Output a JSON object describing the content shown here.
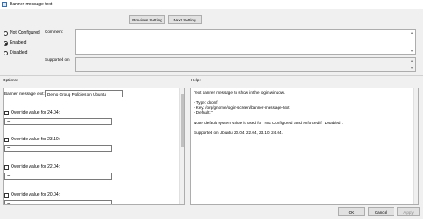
{
  "window": {
    "title": "Banner message text"
  },
  "nav": {
    "previous_label": "Previous Setting",
    "next_label": "Next Setting"
  },
  "state": {
    "options": [
      {
        "label": "Not Configured",
        "selected": false
      },
      {
        "label": "Enabled",
        "selected": true
      },
      {
        "label": "Disabled",
        "selected": false
      }
    ]
  },
  "labels": {
    "comment": "Comment:",
    "supported_on": "Supported on:",
    "options": "Options:",
    "help": "Help:"
  },
  "options_panel": {
    "banner_label": "Banner message text:",
    "banner_value": "Demo Group Policies on Ubuntu",
    "overrides": [
      {
        "label": "Override value for 24.04:",
        "value": "\"\""
      },
      {
        "label": "Override value for 23.10:",
        "value": "\"\""
      },
      {
        "label": "Override value for 22.04:",
        "value": "\"\""
      },
      {
        "label": "Override value for 20.04:",
        "value": "\"\""
      }
    ]
  },
  "help_text": [
    "Text banner message to show in the login window.",
    "",
    "- Type: dconf",
    "- Key: /org/gnome/login-screen/banner-message-text",
    "- Default: ''",
    "",
    "Note: default system value is used for \"Not Configured\" and enforced if \"Disabled\".",
    "",
    "Supported on Ubuntu 20.04, 22.04, 23.10, 24.04."
  ],
  "footer": {
    "ok_label": "OK",
    "cancel_label": "Cancel",
    "apply_label": "Apply"
  }
}
